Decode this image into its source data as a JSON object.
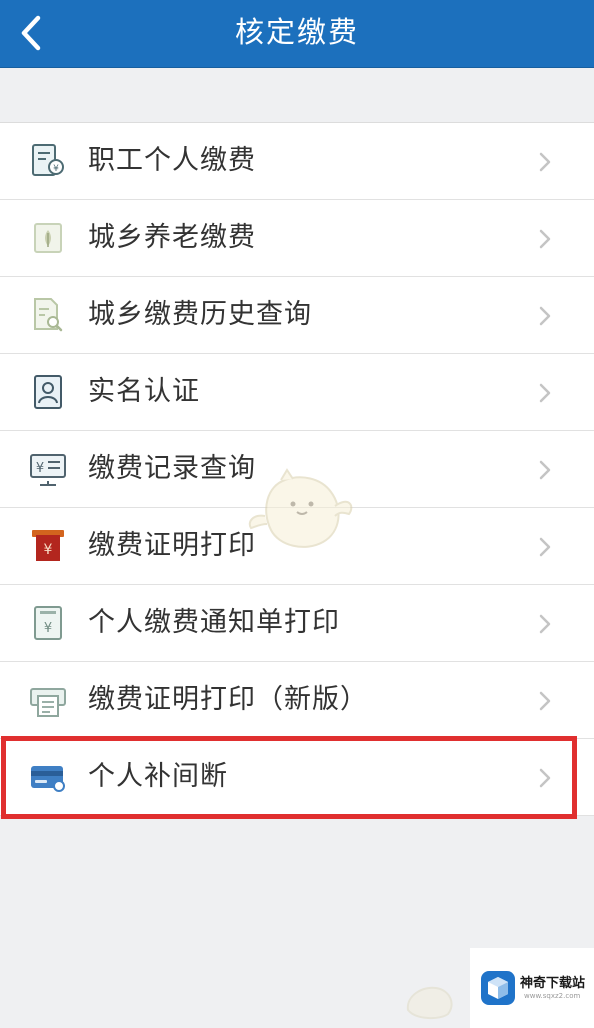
{
  "header": {
    "title": "核定缴费",
    "back_icon": "chevron-left-icon"
  },
  "menu": {
    "items": [
      {
        "label": "职工个人缴费",
        "icon": "document-coin-icon"
      },
      {
        "label": "城乡养老缴费",
        "icon": "rice-badge-icon"
      },
      {
        "label": "城乡缴费历史查询",
        "icon": "document-search-icon"
      },
      {
        "label": "实名认证",
        "icon": "id-card-icon"
      },
      {
        "label": "缴费记录查询",
        "icon": "monitor-yen-icon"
      },
      {
        "label": "缴费证明打印",
        "icon": "certificate-print-icon"
      },
      {
        "label": "个人缴费通知单打印",
        "icon": "notice-print-icon"
      },
      {
        "label": "缴费证明打印（新版）",
        "icon": "printer-doc-icon"
      },
      {
        "label": "个人补间断",
        "icon": "bank-card-icon"
      }
    ],
    "highlighted_item": "个人补间断"
  },
  "watermark": {
    "title": "神奇下载站",
    "url": "www.sqxz2.com"
  },
  "colors": {
    "header_bg": "#1c70bd",
    "highlight_border": "#e02f2f",
    "page_bg": "#eff0f2"
  }
}
